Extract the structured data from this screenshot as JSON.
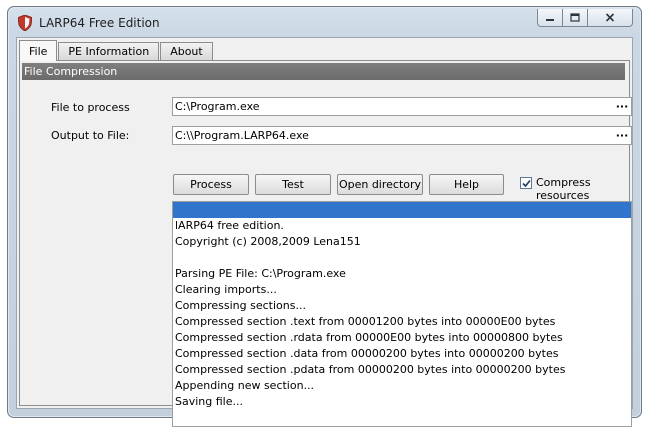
{
  "window": {
    "title": "LARP64 Free Edition"
  },
  "icons": {
    "app": "larp-shield-icon",
    "minimize": "minimize-icon",
    "maximize": "maximize-icon",
    "close": "close-icon"
  },
  "tabs": [
    {
      "label": "File",
      "active": true
    },
    {
      "label": "PE Information",
      "active": false
    },
    {
      "label": "About",
      "active": false
    }
  ],
  "section": {
    "title": "File Compression"
  },
  "file_to_process": {
    "label": "File to process",
    "value": "C:\\Program.exe",
    "browse": "···"
  },
  "output_to_file": {
    "label": "Output to File:",
    "value": "C:\\\\Program.LARP64.exe",
    "browse": "···"
  },
  "buttons": {
    "process": "Process",
    "test": "Test",
    "open_directory": "Open directory",
    "help": "Help"
  },
  "compress_resources": {
    "label": "Compress resources",
    "checked": true
  },
  "log": {
    "lines": [
      "lARP64 free edition.",
      "Copyright (c) 2008,2009 Lena151",
      "",
      "Parsing PE File: C:\\Program.exe",
      "Clearing imports...",
      "Compressing sections...",
      "Compressed section .text from 00001200 bytes into 00000E00 bytes",
      "Compressed section .rdata from 00000E00 bytes into 00000800 bytes",
      "Compressed section .data from 00000200 bytes into 00000200 bytes",
      "Compressed section .pdata from 00000200 bytes into 00000200 bytes",
      "Appending new section...",
      "Saving file..."
    ]
  },
  "colors": {
    "selection": "#3074cc",
    "group_header": "#757575",
    "frame": "#c9d6e2"
  }
}
